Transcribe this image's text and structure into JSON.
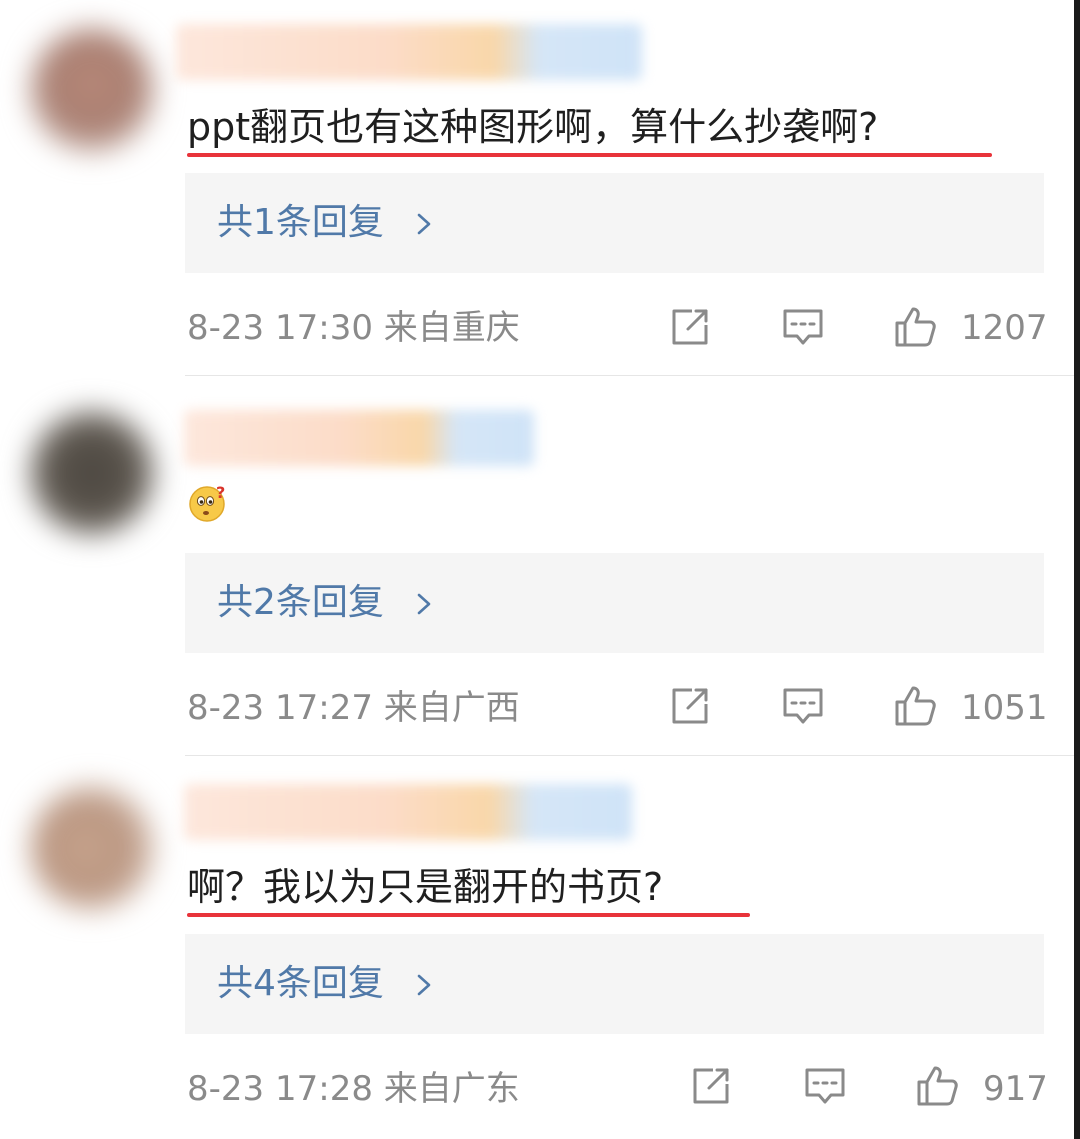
{
  "comments": [
    {
      "text": "ppt翻页也有这种图形啊，算什么抄袭啊?",
      "reply_label": "共1条回复",
      "time": "8-23 17:30",
      "location": "来自重庆",
      "likes": "1207"
    },
    {
      "emoji": "thinking-question-emoji",
      "reply_label": "共2条回复",
      "time": "8-23 17:27",
      "location": "来自广西",
      "likes": "1051"
    },
    {
      "text": "啊？我以为只是翻开的书页?",
      "reply_label": "共4条回复",
      "time": "8-23 17:28",
      "location": "来自广东",
      "likes": "917"
    }
  ],
  "colors": {
    "reply_link": "#5079a8",
    "highlight_underline": "#e8333a",
    "meta_text": "#8a8a8a"
  },
  "icons": {
    "share": "share-edit-icon",
    "comment": "comment-icon",
    "like": "thumbs-up-icon",
    "chevron": "chevron-right-icon"
  }
}
